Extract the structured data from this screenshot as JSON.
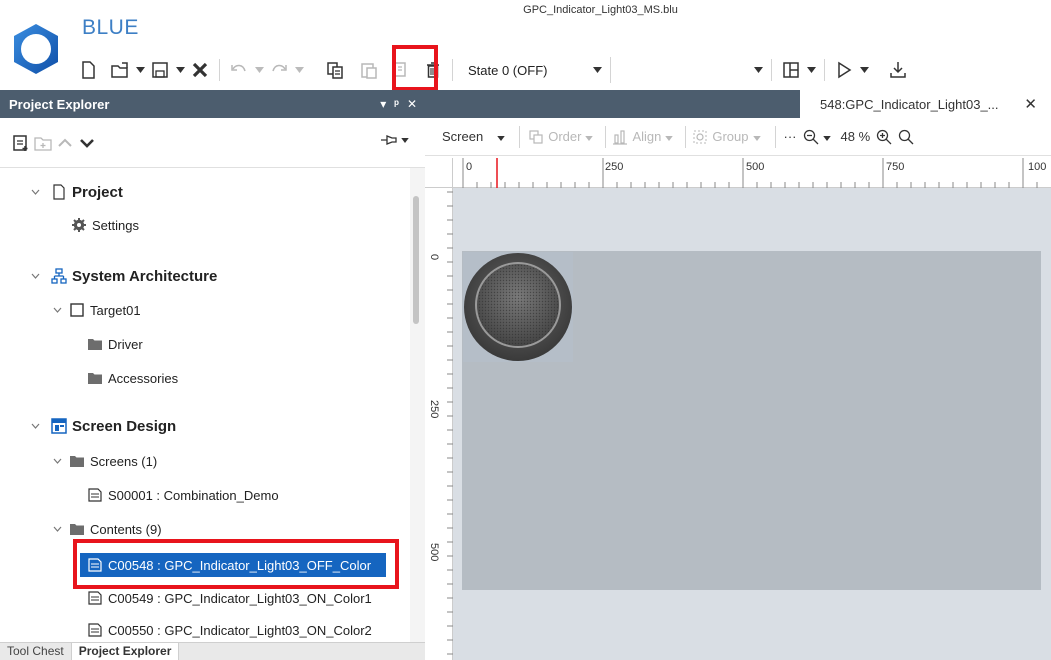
{
  "app": {
    "brand": "BLUE",
    "doc_title": "GPC_Indicator_Light03_MS.blu"
  },
  "toolbar": {
    "state_value": "State 0 (OFF)",
    "icons": [
      "new-file-icon",
      "open-folder-icon",
      "save-icon",
      "close-x-icon",
      "undo-icon",
      "redo-icon",
      "copy-icon",
      "paste-icon",
      "duplicate-icon",
      "delete-icon",
      "layout-icon",
      "play-icon",
      "download-icon"
    ]
  },
  "left_panel": {
    "title": "Project Explorer",
    "header_controls": [
      "▾",
      "ᵖ",
      "✕"
    ]
  },
  "tree": {
    "project": "Project",
    "settings": "Settings",
    "system_architecture": "System Architecture",
    "target": "Target01",
    "driver": "Driver",
    "accessories": "Accessories",
    "screen_design": "Screen Design",
    "screens": "Screens (1)",
    "screen_item": "S00001 : Combination_Demo",
    "contents": "Contents (9)",
    "content_items": [
      "C00548 : GPC_Indicator_Light03_OFF_Color",
      "C00549 : GPC_Indicator_Light03_ON_Color1",
      "C00550 : GPC_Indicator_Light03_ON_Color2"
    ]
  },
  "bottom_tabs": [
    "Tool Chest",
    "Project Explorer"
  ],
  "document": {
    "tab_label": "548:GPC_Indicator_Light03_...",
    "close": "✕"
  },
  "editor_bar": {
    "screen": "Screen",
    "order": "Order",
    "align": "Align",
    "group": "Group",
    "more": "···",
    "zoom": "48 %"
  },
  "ruler": {
    "top_labels": [
      "0",
      "250",
      "500",
      "750",
      "100"
    ],
    "left_labels": [
      "0",
      "250",
      "500"
    ]
  },
  "colors": {
    "panel_header": "#4c5d6e",
    "selection": "#1565c0",
    "highlight": "#e8141c",
    "brand": "#3d7fc5"
  }
}
